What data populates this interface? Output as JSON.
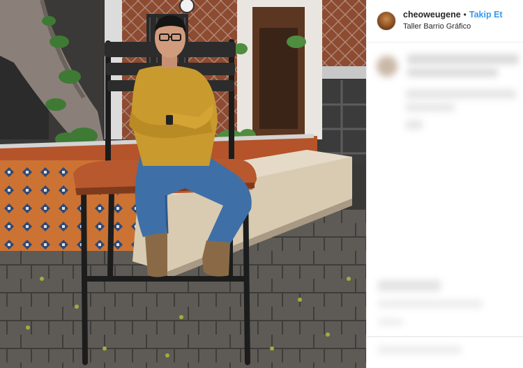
{
  "post": {
    "username": "cheoweugene",
    "separator": "•",
    "follow_label": "Takip Et",
    "location": "Taller Barrio Gráfico"
  },
  "colors": {
    "follow_blue": "#3897f0",
    "username_text": "#262626",
    "shirt_mustard": "#c99a2e",
    "jeans_blue": "#3f6fa7",
    "seat_leather": "#b8582e"
  },
  "icons": {
    "avatar": "profile-avatar"
  }
}
